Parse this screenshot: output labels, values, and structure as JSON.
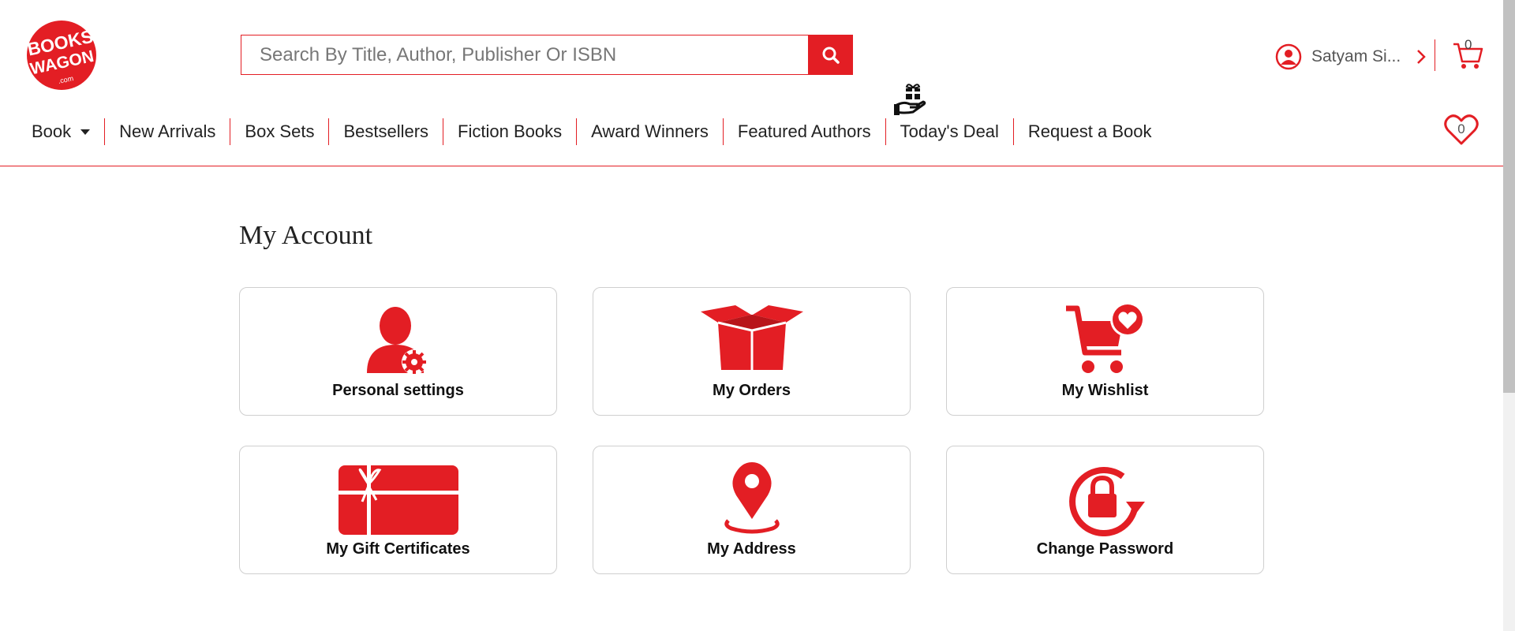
{
  "brand": {
    "logo_text_1": "BOOKS",
    "logo_text_2": "WAGON",
    "logo_text_3": ".com",
    "accent_color": "#e31e24"
  },
  "search": {
    "placeholder": "Search By Title, Author, Publisher Or ISBN",
    "value": "",
    "icon": "search-icon"
  },
  "account": {
    "icon": "user-circle-icon",
    "name": "Satyam Si...",
    "chevron_icon": "chevron-right-icon"
  },
  "cart": {
    "icon": "cart-icon",
    "count": "0"
  },
  "wishlist_header": {
    "icon": "heart-icon",
    "count": "0"
  },
  "nav": {
    "items": [
      {
        "label": "Book",
        "has_dropdown": true
      },
      {
        "label": "New Arrivals"
      },
      {
        "label": "Box Sets"
      },
      {
        "label": "Bestsellers"
      },
      {
        "label": "Fiction Books"
      },
      {
        "label": "Award Winners"
      },
      {
        "label": "Featured Authors"
      },
      {
        "label": "Today's Deal",
        "icon": "gift-hand-icon"
      },
      {
        "label": "Request a Book"
      }
    ]
  },
  "main": {
    "title": "My Account",
    "tiles": [
      {
        "label": "Personal settings",
        "icon": "user-settings-icon"
      },
      {
        "label": "My Orders",
        "icon": "open-box-icon"
      },
      {
        "label": "My Wishlist",
        "icon": "cart-heart-icon"
      },
      {
        "label": "My Gift Certificates",
        "icon": "gift-card-icon"
      },
      {
        "label": "My Address",
        "icon": "map-pin-icon"
      },
      {
        "label": "Change Password",
        "icon": "lock-refresh-icon"
      }
    ]
  }
}
